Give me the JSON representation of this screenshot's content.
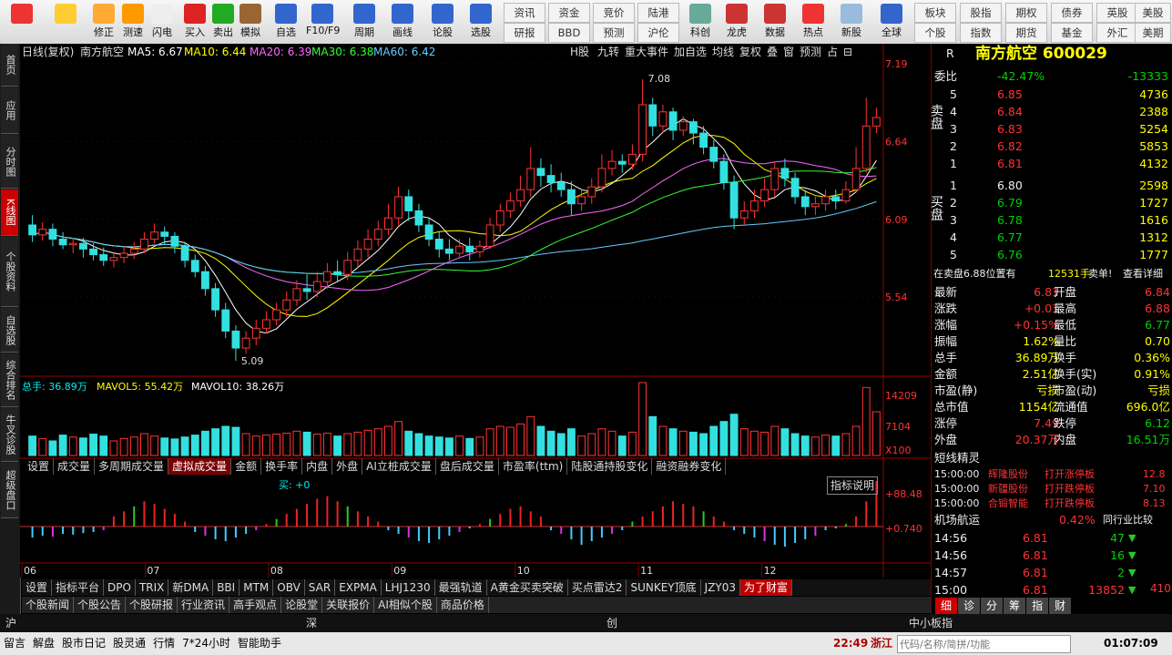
{
  "toolbar": {
    "buttons": [
      {
        "label": "",
        "icon": "windows-logo-icon"
      },
      {
        "label": "",
        "icon": "back-arrow-icon"
      },
      {
        "label": "修正",
        "icon": "up-arrow-icon"
      },
      {
        "label": "测速",
        "icon": "speed-clock-icon"
      },
      {
        "label": "闪电",
        "icon": "stopwatch-icon"
      },
      {
        "label": "买入",
        "icon": "buy-icon"
      },
      {
        "label": "卖出",
        "icon": "sell-icon"
      },
      {
        "label": "模拟",
        "icon": "hammer-icon"
      },
      {
        "label": "自选",
        "icon": "star-icon"
      },
      {
        "label": "F10/F9",
        "icon": "f10-icon"
      },
      {
        "label": "周期",
        "icon": "period-icon"
      },
      {
        "label": "画线",
        "icon": "pencil-icon"
      },
      {
        "label": "论股",
        "icon": "discuss-icon"
      },
      {
        "label": "选股",
        "icon": "select-stock-icon"
      }
    ],
    "text_buttons_top": [
      "资讯",
      "资金",
      "竞价",
      "陆港"
    ],
    "text_buttons_bottom": [
      "研报",
      "BBD",
      "预测",
      "沪伦"
    ],
    "icon_buttons2": [
      {
        "label": "科创",
        "icon": "chart-icon"
      },
      {
        "label": "龙虎",
        "icon": "dragon-icon"
      },
      {
        "label": "数据",
        "icon": "pe-icon"
      },
      {
        "label": "热点",
        "icon": "hot-icon"
      },
      {
        "label": "新股",
        "icon": "ipo-icon"
      },
      {
        "label": "全球",
        "icon": "globe-icon"
      }
    ],
    "right_top": [
      "板块",
      "股指",
      "期权",
      "债券",
      "英股",
      "美股"
    ],
    "right_bottom": [
      "个股",
      "指数",
      "期货",
      "基金",
      "外汇",
      "美期"
    ]
  },
  "left_tabs": [
    {
      "label": "首页",
      "active": false
    },
    {
      "label": "应用",
      "active": false
    },
    {
      "label": "分时图",
      "active": false
    },
    {
      "label": "K线图",
      "active": true
    },
    {
      "label": "个股资料",
      "active": false
    },
    {
      "label": "自选股",
      "active": false
    },
    {
      "label": "综合排名",
      "active": false
    },
    {
      "label": "牛叉诊股",
      "active": false
    },
    {
      "label": "超级盘口",
      "active": false
    }
  ],
  "chart_header": {
    "period": "日线(复权)",
    "stock": "南方航空",
    "ma5": "MA5: 6.67",
    "ma10": "MA10: 6.44",
    "ma20": "MA20: 6.39",
    "ma30": "MA30: 6.38",
    "ma60": "MA60: 6.42",
    "tools": [
      "H股",
      "九转",
      "重大事件",
      "加自选",
      "均线",
      "复权",
      "叠",
      "窗",
      "预测",
      "占",
      "⊟"
    ]
  },
  "chart_data": {
    "type": "candlestick",
    "price_axis_ticks": [
      "7.19",
      "6.64",
      "6.09",
      "5.54"
    ],
    "price_range": [
      5.0,
      7.19
    ],
    "high_label": "7.08",
    "low_label": "5.09",
    "x_months": [
      "06",
      "07",
      "08",
      "09",
      "10",
      "11",
      "12"
    ],
    "candles": [
      [
        6.05,
        5.98,
        6.12,
        5.93
      ],
      [
        5.98,
        6.02,
        6.07,
        5.94
      ],
      [
        6.02,
        5.95,
        6.06,
        5.9
      ],
      [
        5.95,
        5.91,
        6.0,
        5.88
      ],
      [
        5.91,
        5.92,
        5.96,
        5.85
      ],
      [
        5.92,
        5.88,
        5.96,
        5.82
      ],
      [
        5.88,
        5.84,
        5.92,
        5.8
      ],
      [
        5.84,
        5.8,
        5.89,
        5.76
      ],
      [
        5.8,
        5.82,
        5.86,
        5.75
      ],
      [
        5.82,
        5.85,
        5.9,
        5.78
      ],
      [
        5.85,
        5.88,
        5.93,
        5.81
      ],
      [
        5.88,
        5.95,
        6.0,
        5.85
      ],
      [
        5.95,
        6.0,
        6.06,
        5.92
      ],
      [
        6.0,
        5.97,
        6.04,
        5.91
      ],
      [
        5.97,
        5.9,
        6.0,
        5.85
      ],
      [
        5.9,
        5.8,
        5.93,
        5.75
      ],
      [
        5.8,
        5.72,
        5.84,
        5.68
      ],
      [
        5.72,
        5.6,
        5.76,
        5.55
      ],
      [
        5.6,
        5.45,
        5.64,
        5.4
      ],
      [
        5.45,
        5.3,
        5.5,
        5.25
      ],
      [
        5.3,
        5.18,
        5.34,
        5.09
      ],
      [
        5.18,
        5.25,
        5.3,
        5.14
      ],
      [
        5.25,
        5.32,
        5.38,
        5.2
      ],
      [
        5.32,
        5.38,
        5.44,
        5.28
      ],
      [
        5.38,
        5.45,
        5.5,
        5.34
      ],
      [
        5.45,
        5.52,
        5.58,
        5.4
      ],
      [
        5.52,
        5.6,
        5.66,
        5.48
      ],
      [
        5.6,
        5.58,
        5.7,
        5.52
      ],
      [
        5.58,
        5.65,
        5.72,
        5.54
      ],
      [
        5.65,
        5.72,
        5.78,
        5.6
      ],
      [
        5.72,
        5.7,
        5.8,
        5.65
      ],
      [
        5.7,
        5.8,
        5.86,
        5.66
      ],
      [
        5.8,
        5.88,
        5.94,
        5.75
      ],
      [
        5.88,
        5.95,
        6.02,
        5.82
      ],
      [
        5.95,
        6.02,
        6.08,
        5.9
      ],
      [
        6.02,
        6.1,
        6.2,
        5.98
      ],
      [
        6.1,
        6.25,
        6.32,
        6.05
      ],
      [
        6.25,
        6.15,
        6.3,
        6.08
      ],
      [
        6.15,
        6.05,
        6.2,
        6.0
      ],
      [
        6.05,
        5.95,
        6.1,
        5.9
      ],
      [
        5.95,
        5.88,
        6.0,
        5.82
      ],
      [
        5.88,
        5.85,
        5.95,
        5.8
      ],
      [
        5.85,
        5.9,
        5.95,
        5.82
      ],
      [
        5.9,
        5.86,
        5.96,
        5.8
      ],
      [
        5.86,
        5.9,
        5.94,
        5.82
      ],
      [
        5.9,
        6.05,
        6.1,
        5.88
      ],
      [
        6.05,
        6.15,
        6.2,
        6.0
      ],
      [
        6.15,
        6.22,
        6.28,
        6.1
      ],
      [
        6.22,
        6.3,
        6.4,
        6.18
      ],
      [
        6.3,
        6.45,
        6.6,
        6.25
      ],
      [
        6.45,
        6.4,
        6.52,
        6.32
      ],
      [
        6.4,
        6.35,
        6.48,
        6.28
      ],
      [
        6.35,
        6.3,
        6.42,
        6.25
      ],
      [
        6.3,
        6.2,
        6.36,
        6.12
      ],
      [
        6.2,
        6.25,
        6.3,
        6.15
      ],
      [
        6.25,
        6.32,
        6.38,
        6.2
      ],
      [
        6.32,
        6.45,
        6.55,
        6.28
      ],
      [
        6.45,
        6.5,
        6.58,
        6.4
      ],
      [
        6.5,
        6.48,
        6.55,
        6.42
      ],
      [
        6.48,
        6.55,
        6.62,
        6.44
      ],
      [
        6.55,
        6.9,
        7.08,
        6.5
      ],
      [
        6.9,
        6.75,
        6.95,
        6.68
      ],
      [
        6.75,
        6.85,
        6.9,
        6.7
      ],
      [
        6.85,
        6.72,
        6.88,
        6.65
      ],
      [
        6.72,
        6.78,
        6.82,
        6.68
      ],
      [
        6.78,
        6.7,
        6.8,
        6.62
      ],
      [
        6.7,
        6.6,
        6.75,
        6.55
      ],
      [
        6.6,
        6.5,
        6.65,
        6.45
      ],
      [
        6.5,
        6.35,
        6.55,
        6.3
      ],
      [
        6.35,
        6.1,
        6.4,
        6.02
      ],
      [
        6.1,
        6.15,
        6.22,
        6.05
      ],
      [
        6.15,
        6.22,
        6.3,
        6.1
      ],
      [
        6.22,
        6.3,
        6.38,
        6.18
      ],
      [
        6.3,
        6.45,
        6.5,
        6.25
      ],
      [
        6.45,
        6.38,
        6.52,
        6.32
      ],
      [
        6.38,
        6.25,
        6.42,
        6.2
      ],
      [
        6.25,
        6.18,
        6.3,
        6.12
      ],
      [
        6.18,
        6.2,
        6.25,
        6.12
      ],
      [
        6.2,
        6.25,
        6.3,
        6.15
      ],
      [
        6.25,
        6.22,
        6.3,
        6.16
      ],
      [
        6.22,
        6.3,
        6.36,
        6.2
      ],
      [
        6.3,
        6.45,
        6.6,
        6.28
      ],
      [
        6.45,
        6.75,
        6.95,
        6.42
      ],
      [
        6.75,
        6.81,
        6.88,
        6.7
      ]
    ],
    "vol_axis_ticks": [
      "14209",
      "7104",
      "X100"
    ],
    "vol_header": {
      "total": "总手: 36.89万",
      "mavol5": "MAVOL5: 55.42万",
      "mavol10": "MAVOL10: 38.26万"
    },
    "volumes": [
      40,
      35,
      30,
      42,
      38,
      36,
      44,
      40,
      30,
      35,
      38,
      45,
      40,
      36,
      34,
      38,
      42,
      50,
      55,
      60,
      58,
      45,
      40,
      42,
      44,
      46,
      50,
      48,
      44,
      46,
      40,
      45,
      48,
      52,
      55,
      60,
      70,
      50,
      45,
      40,
      38,
      36,
      40,
      35,
      38,
      55,
      60,
      58,
      65,
      80,
      60,
      50,
      45,
      55,
      40,
      45,
      55,
      50,
      40,
      48,
      150,
      80,
      60,
      55,
      50,
      48,
      45,
      60,
      70,
      85,
      55,
      50,
      48,
      60,
      55,
      45,
      40,
      38,
      42,
      40,
      45,
      60,
      140,
      90
    ],
    "indicator_ticks": [
      "+88.48",
      "+0.740"
    ],
    "indicator_note": "买: +0",
    "indicator_values": [
      -30,
      -25,
      -28,
      -20,
      -22,
      -18,
      -15,
      -10,
      20,
      30,
      40,
      50,
      45,
      35,
      25,
      10,
      -15,
      -25,
      -35,
      -40,
      -30,
      -20,
      -10,
      5,
      15,
      25,
      35,
      45,
      55,
      60,
      50,
      40,
      30,
      20,
      10,
      -10,
      -20,
      -30,
      -40,
      -45,
      -35,
      -25,
      -15,
      -5,
      5,
      15,
      25,
      35,
      40,
      30,
      20,
      -10,
      -20,
      -35,
      -50,
      -40,
      -30,
      -20,
      -10,
      10,
      20,
      30,
      40,
      50,
      45,
      40,
      30,
      20,
      10,
      -10,
      -20,
      -30,
      -40,
      -50,
      -55,
      -45,
      -35,
      -25,
      -10,
      -5,
      5,
      20,
      50,
      90
    ]
  },
  "sub_tabs_1": [
    "设置",
    "成交量",
    "多周期成交量",
    "虚拟成交量",
    "金额",
    "换手率",
    "内盘",
    "外盘",
    "AI立桩成交量",
    "盘后成交量",
    "市盈率(ttm)",
    "陆股通持股变化",
    "融资融券变化"
  ],
  "indicator_btn": "指标说明",
  "sub_tabs_2": [
    "设置",
    "指标平台",
    "DPO",
    "TRIX",
    "新DMA",
    "BBI",
    "MTM",
    "OBV",
    "SAR",
    "EXPMA",
    "LHJ1230",
    "最强轨道",
    "A黄金买卖突破",
    "买点雷达2",
    "SUNKEY顶底",
    "JZY03",
    "为了财富"
  ],
  "sub_tabs_3": [
    "个股新闻",
    "个股公告",
    "个股研报",
    "行业资讯",
    "高手观点",
    "论股堂",
    "关联报价",
    "AI相似个股",
    "商品价格"
  ],
  "quote": {
    "r_label": "R",
    "name": "南方航空 600029",
    "weibi_label": "委比",
    "weibi": "-42.47%",
    "weicha": "-13333",
    "sell_label": "卖盘",
    "buy_label": "买盘",
    "asks": [
      {
        "lvl": "5",
        "price": "6.85",
        "vol": "4736"
      },
      {
        "lvl": "4",
        "price": "6.84",
        "vol": "2388"
      },
      {
        "lvl": "3",
        "price": "6.83",
        "vol": "5254"
      },
      {
        "lvl": "2",
        "price": "6.82",
        "vol": "5853"
      },
      {
        "lvl": "1",
        "price": "6.81",
        "vol": "4132"
      }
    ],
    "bids": [
      {
        "lvl": "1",
        "price": "6.80",
        "vol": "2598"
      },
      {
        "lvl": "2",
        "price": "6.79",
        "vol": "1727"
      },
      {
        "lvl": "3",
        "price": "6.78",
        "vol": "1616"
      },
      {
        "lvl": "4",
        "price": "6.77",
        "vol": "1312"
      },
      {
        "lvl": "5",
        "price": "6.76",
        "vol": "1777"
      }
    ],
    "note_left": "在卖盘6.88位置有",
    "note_vol": "12531手",
    "note_act": "卖单!",
    "note_link": "查看详细",
    "stats": [
      [
        "最新",
        "6.81",
        "开盘",
        "6.84"
      ],
      [
        "涨跌",
        "+0.01",
        "最高",
        "6.88"
      ],
      [
        "涨幅",
        "+0.15%",
        "最低",
        "6.77"
      ],
      [
        "振幅",
        "1.62%",
        "量比",
        "0.70"
      ],
      [
        "总手",
        "36.89万",
        "换手",
        "0.36%"
      ],
      [
        "金额",
        "2.51亿",
        "换手(实)",
        "0.91%"
      ],
      [
        "市盈(静)",
        "亏损",
        "市盈(动)",
        "亏损"
      ],
      [
        "总市值",
        "1154亿",
        "流通值",
        "696.0亿"
      ],
      [
        "涨停",
        "7.49",
        "跌停",
        "6.12"
      ],
      [
        "外盘",
        "20.37万",
        "内盘",
        "16.51万"
      ]
    ],
    "short_title": "短线精灵",
    "short_items": [
      [
        "15:00:00",
        "辉隆股份",
        "打开涨停板",
        "12.8"
      ],
      [
        "15:00:00",
        "新疆股份",
        "打开跌停板",
        "7.10"
      ],
      [
        "15:00:00",
        "合锻智能",
        "打开跌停板",
        "8.13"
      ]
    ],
    "sector_name": "机场航运",
    "sector_pct": "0.42%",
    "sector_link": "同行业比较",
    "ticks": [
      [
        "14:56",
        "6.81",
        "47",
        "down"
      ],
      [
        "14:56",
        "6.81",
        "16",
        "down"
      ],
      [
        "14:57",
        "6.81",
        "2",
        "down"
      ],
      [
        "15:00",
        "6.81",
        "13852",
        "down"
      ]
    ],
    "tick_extra": "410",
    "bottom_tabs": [
      "细",
      "诊",
      "分",
      "筹",
      "指",
      "财"
    ]
  },
  "status": {
    "row1": {
      "sh": "沪",
      "sz": "深",
      "cy": "创",
      "zxb": "中小板指"
    },
    "row2_items": [
      "留言",
      "解盘",
      "股市日记",
      "股灵通",
      "行情",
      "7*24小时",
      "智能助手"
    ],
    "time1": "22:49",
    "region": "浙江",
    "search_placeholder": "代码/名称/简拼/功能",
    "time2": "01:07:09"
  }
}
